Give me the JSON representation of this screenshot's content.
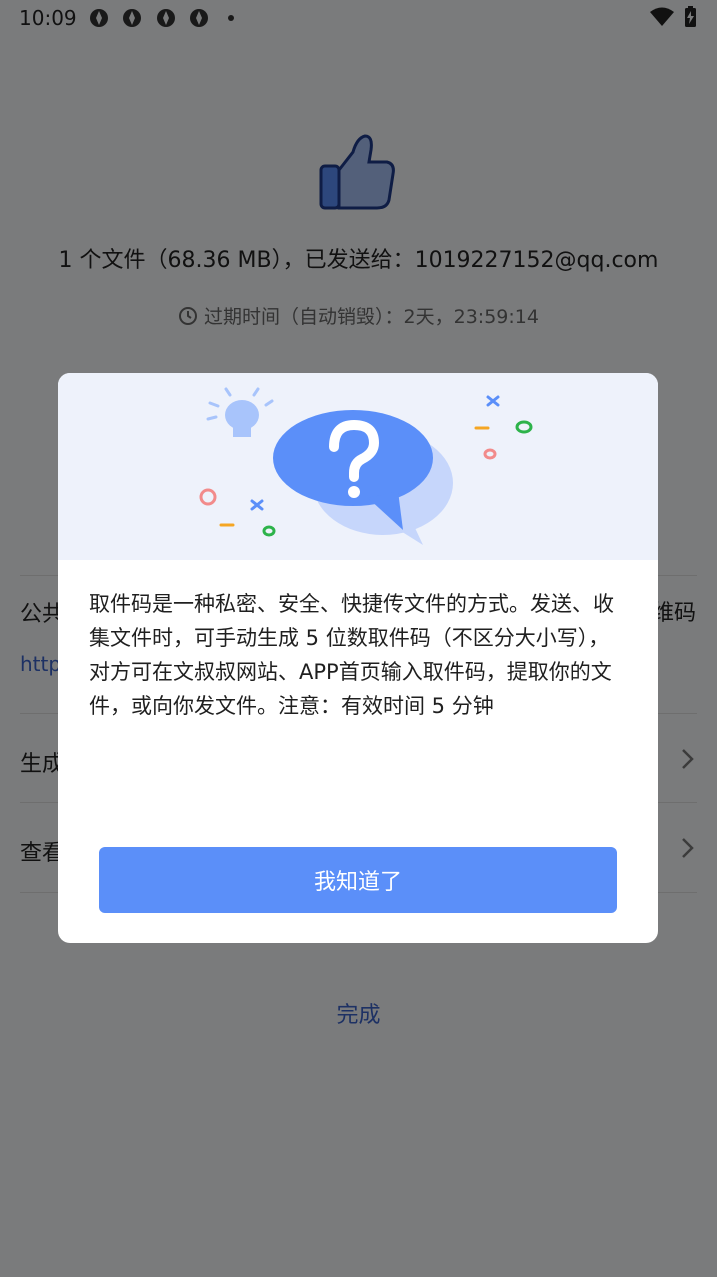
{
  "status_bar": {
    "time": "10:09",
    "icons": [
      "notification-icon",
      "notification-icon",
      "notification-icon",
      "notification-icon",
      "dot-icon",
      "wifi-icon",
      "battery-charging-icon"
    ]
  },
  "result": {
    "summary": "1 个文件（68.36 MB），已发送给：1019227152@qq.com",
    "expiry": "过期时间（自动销毁）：2天，23:59:14"
  },
  "list": {
    "share_label_partial": "公共",
    "share_right_partial": "维码",
    "share_link_partial": "http",
    "generate_partial": "生成",
    "view_partial": "查看"
  },
  "done_label": "完成",
  "dialog": {
    "message": "取件码是一种私密、安全、快捷传文件的方式。发送、收集文件时，可手动生成 5 位数取件码（不区分大小写），对方可在文叔叔网站、APP首页输入取件码，提取你的文件，或向你发文件。注意：有效时间 5 分钟",
    "confirm_label": "我知道了"
  },
  "colors": {
    "accent": "#5b8ff9",
    "link": "#3a62c9",
    "overlay": "rgba(0,0,0,0.5)"
  }
}
